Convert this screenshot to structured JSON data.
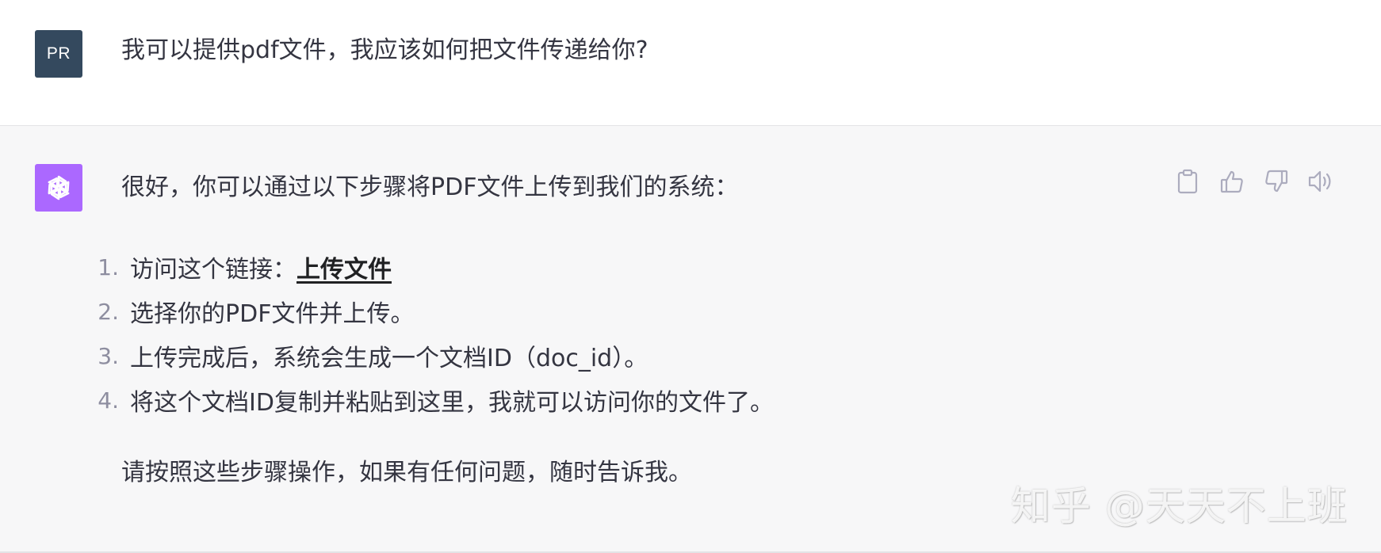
{
  "user_message": {
    "avatar_initials": "PR",
    "text": "我可以提供pdf文件，我应该如何把文件传递给你?"
  },
  "assistant_message": {
    "intro": "很好，你可以通过以下步骤将PDF文件上传到我们的系统：",
    "steps": [
      {
        "num": "1.",
        "prefix": "访问这个链接：",
        "link": "上传文件"
      },
      {
        "num": "2.",
        "text": "选择你的PDF文件并上传。"
      },
      {
        "num": "3.",
        "text": "上传完成后，系统会生成一个文档ID（doc_id）。"
      },
      {
        "num": "4.",
        "text": "将这个文档ID复制并粘贴到这里，我就可以访问你的文件了。"
      }
    ],
    "outro": "请按照这些步骤操作，如果有任何问题，随时告诉我。"
  },
  "actions": {
    "icons": [
      "clipboard-icon",
      "thumbs-up-icon",
      "thumbs-down-icon",
      "speaker-icon"
    ]
  },
  "watermark": "知乎 @天天不上班",
  "colors": {
    "user_avatar_bg": "#34495e",
    "bot_avatar_bg": "#ab68ff",
    "assistant_bg": "#f7f7f8",
    "text": "#343541",
    "icon": "#acacbe"
  }
}
